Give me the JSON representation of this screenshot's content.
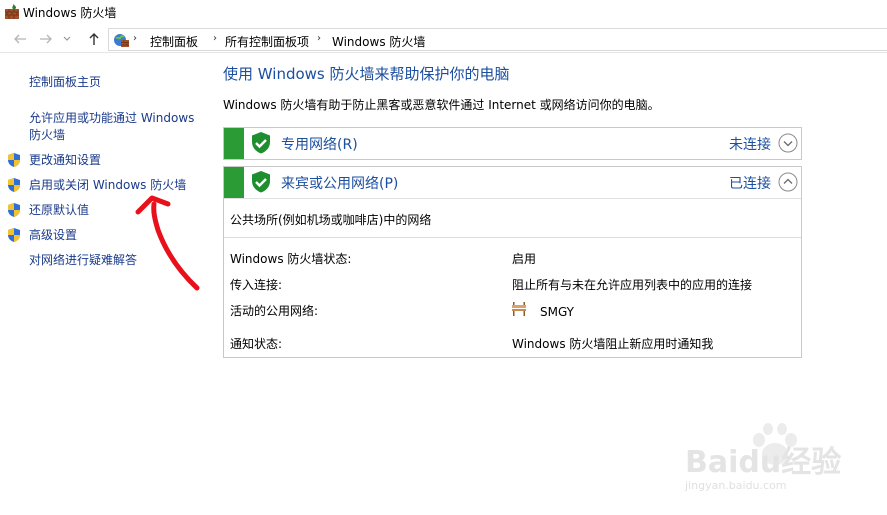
{
  "window": {
    "title": "Windows 防火墙"
  },
  "address": {
    "crumbs": [
      "控制面板",
      "所有控制面板项",
      "Windows 防火墙"
    ],
    "separator": "›",
    "first_separator": "›"
  },
  "sidebar": {
    "links": [
      {
        "label": "控制面板主页",
        "shield": false
      },
      {
        "label": "允许应用或功能通过 Windows",
        "label2": "防火墙",
        "shield": false
      },
      {
        "label": "更改通知设置",
        "shield": true
      },
      {
        "label": "启用或关闭 Windows 防火墙",
        "shield": true
      },
      {
        "label": "还原默认值",
        "shield": true
      },
      {
        "label": "高级设置",
        "shield": true
      },
      {
        "label": "对网络进行疑难解答",
        "shield": false
      }
    ]
  },
  "main": {
    "title": "使用 Windows 防火墙来帮助保护你的电脑",
    "description": "Windows 防火墙有助于防止黑客或恶意软件通过 Internet 或网络访问你的电脑。"
  },
  "private_network": {
    "name": "专用网络(R)",
    "status": "未连接",
    "expanded": false
  },
  "public_network": {
    "name": "来宾或公用网络(P)",
    "status": "已连接",
    "expanded": true,
    "subtitle": "公共场所(例如机场或咖啡店)中的网络",
    "details": [
      {
        "label": "Windows 防火墙状态:",
        "value": "启用"
      },
      {
        "label": "传入连接:",
        "value": "阻止所有与未在允许应用列表中的应用的连接"
      },
      {
        "label": "活动的公用网络:",
        "value": "SMGY"
      },
      {
        "label": "通知状态:",
        "value": "Windows 防火墙阻止新应用时通知我"
      }
    ]
  },
  "watermark": {
    "brand": "Baidu经验",
    "url": "jingyan.baidu.com"
  },
  "colors": {
    "link": "#1a3a8a",
    "heading": "#1c4fa0",
    "status_green": "#2b9b35",
    "annotation_red": "#e8101a"
  }
}
